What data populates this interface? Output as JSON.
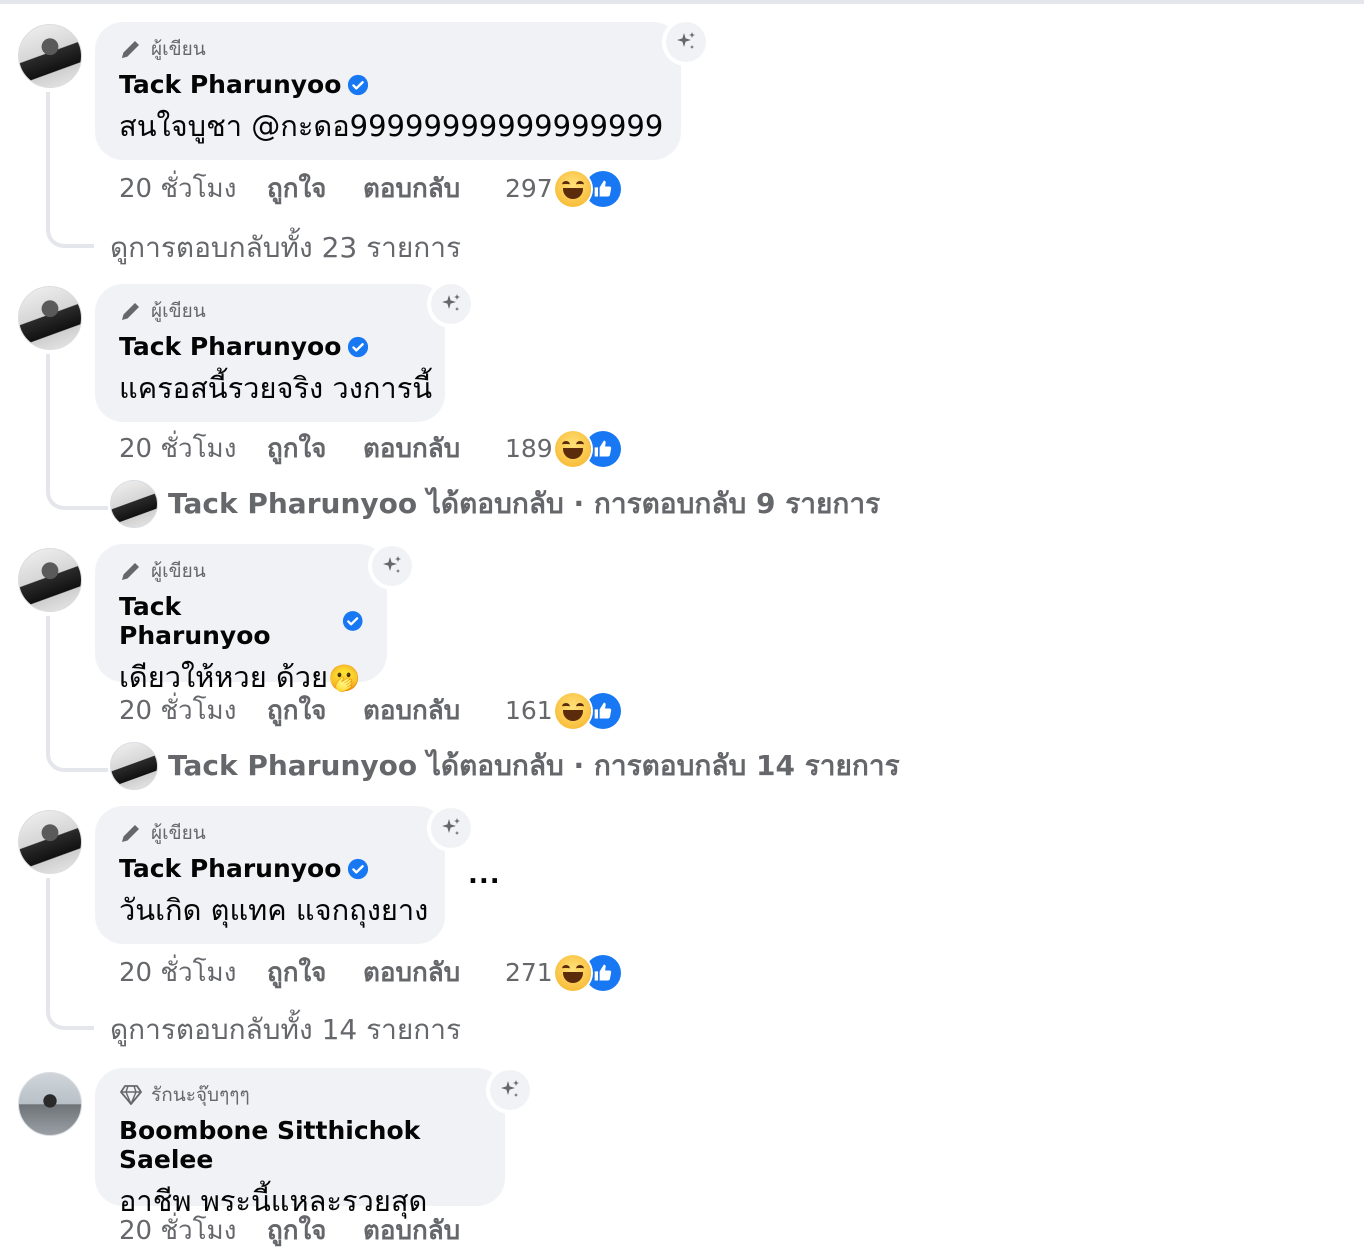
{
  "comments": [
    {
      "badge": "ผู้เขียน",
      "badge_icon": "pencil-icon",
      "author": "Tack Pharunyoo",
      "verified": true,
      "text": "สนใจบูชา @กะดอ99999999999999999",
      "time": "20 ชั่วโมง",
      "like": "ถูกใจ",
      "reply": "ตอบกลับ",
      "reaction_count": "297",
      "replies_text": "ดูการตอบกลับทั้ง 23 รายการ"
    },
    {
      "badge": "ผู้เขียน",
      "badge_icon": "pencil-icon",
      "author": "Tack Pharunyoo",
      "verified": true,
      "text": "แครอสนี้รวยจริง วงการนี้",
      "time": "20 ชั่วโมง",
      "like": "ถูกใจ",
      "reply": "ตอบกลับ",
      "reaction_count": "189",
      "replies_text": "Tack Pharunyoo ได้ตอบกลับ · การตอบกลับ 9 รายการ"
    },
    {
      "badge": "ผู้เขียน",
      "badge_icon": "pencil-icon",
      "author": "Tack Pharunyoo",
      "verified": true,
      "text": "เดียวให้หวย ด้วย",
      "emoji": "🫢",
      "time": "20 ชั่วโมง",
      "like": "ถูกใจ",
      "reply": "ตอบกลับ",
      "reaction_count": "161",
      "replies_text": "Tack Pharunyoo ได้ตอบกลับ · การตอบกลับ 14 รายการ"
    },
    {
      "badge": "ผู้เขียน",
      "badge_icon": "pencil-icon",
      "author": "Tack Pharunyoo",
      "verified": true,
      "text": "วันเกิด ตุแทค แจกถุงยาง",
      "more": "...",
      "time": "20 ชั่วโมง",
      "like": "ถูกใจ",
      "reply": "ตอบกลับ",
      "reaction_count": "271",
      "replies_text": "ดูการตอบกลับทั้ง 14 รายการ"
    },
    {
      "badge": "รักนะจุ๊บๆๆๆ",
      "badge_icon": "diamond-icon",
      "author": "Boombone Sitthichok Saelee",
      "verified": false,
      "text": "อาชีพ พระนี้แหละรวยสุด",
      "time": "20 ชั่วโมง",
      "like": "ถูกใจ",
      "reply": "ตอบกลับ"
    }
  ],
  "colors": {
    "bubble": "#f0f2f5",
    "secondary_text": "#65676b",
    "verified": "#1877f2",
    "like": "#1877f2"
  }
}
